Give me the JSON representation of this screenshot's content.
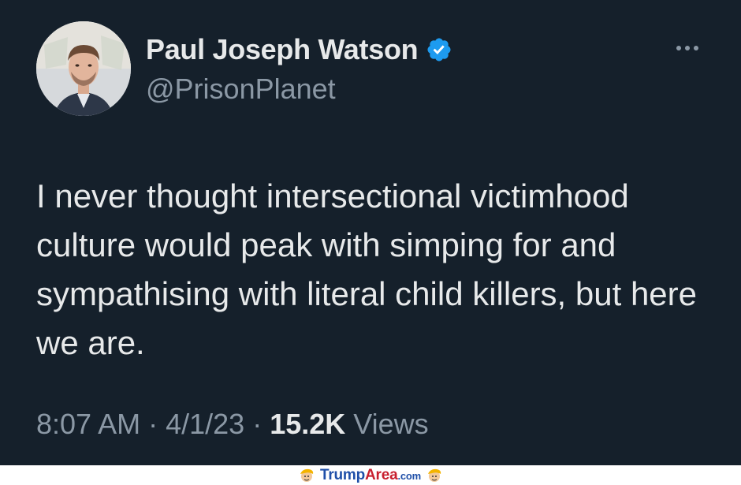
{
  "tweet": {
    "display_name": "Paul Joseph Watson",
    "handle": "@PrisonPlanet",
    "text": "I never thought intersectional victimhood culture would peak with simping for and sympathising with literal child killers, but here we are.",
    "time": "8:07 AM",
    "separator": " · ",
    "date": "4/1/23",
    "views_count": "15.2K",
    "views_label": " Views",
    "verified_color": "#1d9bf0",
    "background_color": "#15202b"
  },
  "watermark": {
    "brand_part1": "Trump",
    "brand_part2": "Area",
    "brand_suffix": ".com"
  },
  "icons": {
    "avatar": "profile-photo",
    "verified": "verified-badge-icon",
    "more": "more-options-icon",
    "mascot": "trump-mascot-icon"
  }
}
